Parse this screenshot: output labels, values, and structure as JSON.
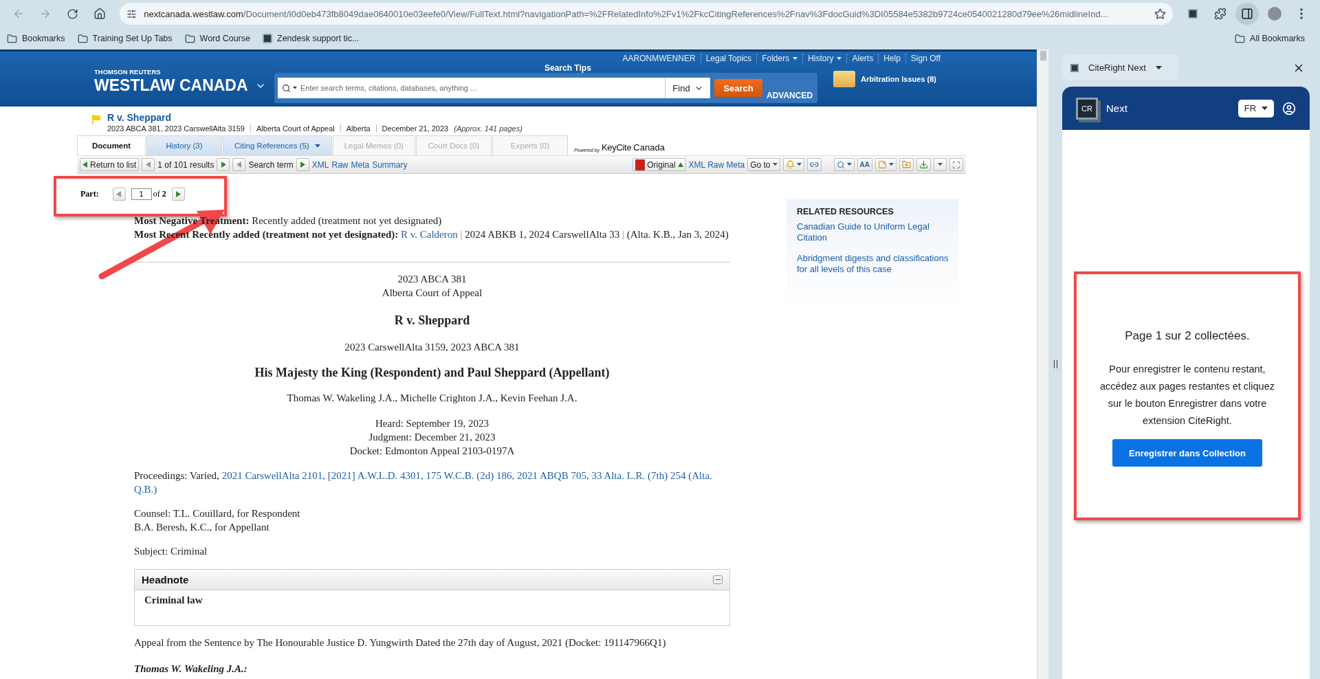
{
  "browser": {
    "url_host": "nextcanada.westlaw.com",
    "url_path": "/Document/I0d0eb473fb8049dae0640010e03eefe0/View/FullText.html?navigationPath=%2FRelatedInfo%2Fv1%2FkcCitingReferences%2Fnav%3FdocGuid%3DI05584e5382b9724ce0540021280d79ee%26midlineInd...",
    "bookmarks": [
      {
        "label": "Bookmarks",
        "kind": "folder"
      },
      {
        "label": "Training Set Up Tabs",
        "kind": "folder"
      },
      {
        "label": "Word Course",
        "kind": "folder"
      },
      {
        "label": "Zendesk support tic...",
        "kind": "site"
      }
    ],
    "all_bookmarks": "All Bookmarks"
  },
  "westlaw": {
    "brand_top": "THOMSON REUTERS",
    "brand": "WESTLAW CANADA",
    "user_links": [
      {
        "label": "AARONMWENNER",
        "dropdown": false
      },
      {
        "label": "Legal Topics",
        "dropdown": false
      },
      {
        "label": "Folders",
        "dropdown": true
      },
      {
        "label": "History",
        "dropdown": true
      },
      {
        "label": "Alerts",
        "dropdown": false
      },
      {
        "label": "Help",
        "dropdown": false
      },
      {
        "label": "Sign Off",
        "dropdown": false
      }
    ],
    "search_tips": "Search Tips",
    "search_placeholder": "Enter search terms, citations, databases, anything ...",
    "find": "Find",
    "search_button": "Search",
    "advanced": "ADVANCED",
    "folder": "Arbitration Issues (8)"
  },
  "document": {
    "title": "R v. Sheppard",
    "meta": [
      "2023 ABCA 381, 2023 CarswellAlta 3159",
      "Alberta Court of Appeal",
      "Alberta",
      "December 21, 2023"
    ],
    "pages": "(Approx. 141 pages)"
  },
  "tabs": [
    {
      "label": "Document",
      "selected": true,
      "disabled": false,
      "dropdown": false
    },
    {
      "label": "History (3)",
      "selected": false,
      "disabled": false,
      "dropdown": false
    },
    {
      "label": "Citing References (5)",
      "selected": false,
      "disabled": false,
      "dropdown": true
    },
    {
      "label": "Legal Memos (0)",
      "selected": false,
      "disabled": true,
      "dropdown": false
    },
    {
      "label": "Court Docs (0)",
      "selected": false,
      "disabled": true,
      "dropdown": false
    },
    {
      "label": "Experts (0)",
      "selected": false,
      "disabled": true,
      "dropdown": false
    }
  ],
  "keycite": {
    "powered": "Powered by",
    "brand": "KeyCite",
    "suffix": "Canada"
  },
  "toolbar": {
    "return": "Return to list",
    "results": "1 of 101 results",
    "search_term": "Search term",
    "links": [
      "XML",
      "Raw",
      "Meta",
      "Summary"
    ],
    "original": "Original",
    "xml_raw_meta": "XML Raw Meta",
    "goto": "Go to",
    "text_size": "AA"
  },
  "part": {
    "label": "Part:",
    "value": "1",
    "of": "of",
    "total": "2"
  },
  "treatment": {
    "negative": "**Most Negative Treatment:** Recently added (treatment not yet designated)",
    "recent_label": "Most Recent Recently added (treatment not yet designated):",
    "recent_link": "R v. Calderon",
    "separator": "|",
    "recent_citation": "2024 ABKB 1, 2024 CarswellAlta 33",
    "recent_court": "(Alta. K.B., Jan 3, 2024)"
  },
  "case": {
    "lines": [
      "2023 ABCA 381",
      "Alberta Court of Appeal"
    ],
    "title": "R v. Sheppard",
    "citation": "2023 CarswellAlta 3159, 2023 ABCA 381",
    "parties": "His Majesty the King (Respondent) and Paul Sheppard (Appellant)",
    "judges": "Thomas W. Wakeling J.A., Michelle Crighton J.A., Kevin Feehan J.A.",
    "dates": [
      "Heard: September 19, 2023",
      "Judgment: December 21, 2023",
      "Docket: Edmonton Appeal 2103-0197A"
    ],
    "proceedings_label": "Proceedings: Varied,",
    "proceedings_separator": ",",
    "proceedings": [
      "2021 CarswellAlta 2101",
      "[2021] A.W.L.D. 4301",
      "175 W.C.B. (2d) 186",
      "2021 ABQB 705",
      "33 Alta. L.R. (7th) 254"
    ],
    "proceedings_court": "(Alta. Q.B.)",
    "counsel": [
      "Counsel: T.L. Couillard, for Respondent",
      "B.A. Beresh, K.C., for Appellant"
    ],
    "subject": "Subject: Criminal",
    "headnote": {
      "title": "Headnote",
      "body": "Criminal law"
    },
    "appeal": "Appeal from the Sentence by The Honourable Justice D. Yungwirth Dated the 27th day of August, 2021 (Docket: 191147966Q1)",
    "judge_heading": "Thomas W. Wakeling J.A.:"
  },
  "related": {
    "title": "RELATED RESOURCES",
    "links": [
      "Canadian Guide to Uniform Legal Citation",
      "Abridgment digests and classifications for all levels of this case"
    ]
  },
  "side_panel": {
    "tab": "CiteRight Next",
    "logo": "CR",
    "brand": "Next",
    "language": "FR",
    "status": "Page 1 sur 2 collectées.",
    "message": "Pour enregistrer le contenu restant, accédez aux pages restantes et cliquez sur le bouton Enregistrer dans votre extension CiteRight.",
    "button": "Enregistrer dans Collection"
  }
}
